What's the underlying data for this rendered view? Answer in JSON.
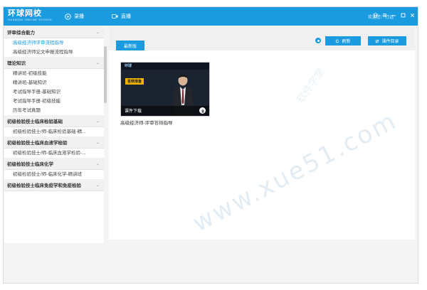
{
  "app": {
    "logo_main": "环球网校",
    "logo_sub": "HUANQIU ONLINE SCHOOL"
  },
  "nav": {
    "tabs": [
      {
        "label": "录播",
        "icon": "play-circle-icon"
      },
      {
        "label": "直播",
        "icon": "video-camera-icon"
      }
    ],
    "user_text": "欢迎您：行远",
    "window_controls": [
      "skin-icon",
      "menu-icon",
      "minimize-icon",
      "maximize-icon",
      "close-icon"
    ]
  },
  "sidebar": {
    "sections": [
      {
        "title": "评审综合能力",
        "items": [
          "高级经济师评审流程指导",
          "高级经济师论文申报流程指导"
        ],
        "active_index": 0
      },
      {
        "title": "理论知识",
        "items": [
          "精讲班-初级技能",
          "精讲班-基础知识",
          "考试指导手册-基础知识",
          "考试指导手册-初级技能",
          "历年考试真题"
        ]
      },
      {
        "title": "初级检验技士临床检验基础",
        "items": [
          "初级检验技士/师-临床检验基础-精..."
        ]
      },
      {
        "title": "初级检验技士临床血液学检验",
        "items": [
          "初级检验技士/师-临床血液学检验-..."
        ]
      },
      {
        "title": "初级检验技士临床化学",
        "items": [
          "初级检验技士/师-临床化学-精讲班"
        ]
      },
      {
        "title": "初级检验技士临床免疫学和免疫检验",
        "items": []
      }
    ]
  },
  "main": {
    "tab_label": "最新版",
    "refresh_label": "刷新",
    "catalog_label": "课件目录",
    "course_card": {
      "brand": "环球",
      "tag": "答辩准备",
      "download_label": "课件下载",
      "caption": "高级经济师-评审答辩指导"
    }
  },
  "watermark": "www.xue51.com",
  "watermark_side": "软件学堂"
}
